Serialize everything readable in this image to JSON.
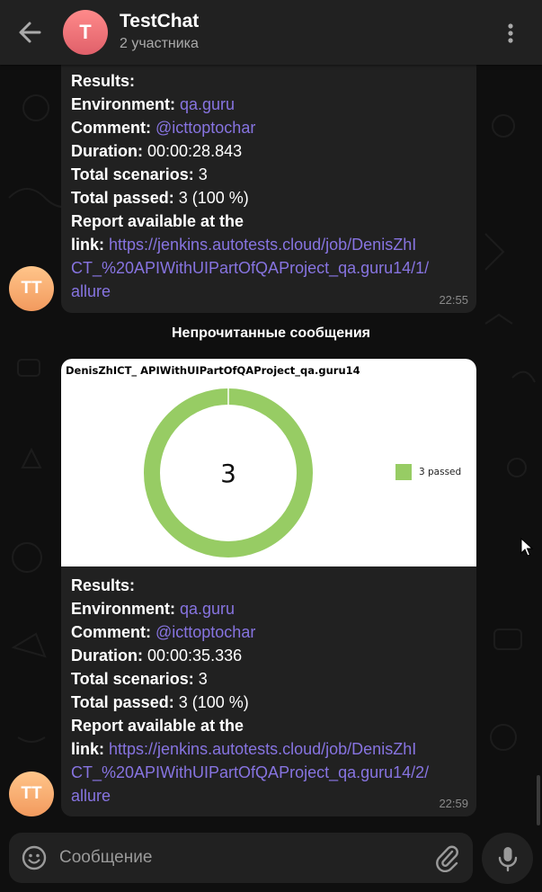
{
  "header": {
    "avatar_letter": "T",
    "title": "TestChat",
    "subtitle": "2 участника",
    "back_icon": "arrow-left-icon",
    "more_icon": "more-vertical-icon"
  },
  "messages": [
    {
      "sender_initials": "TT",
      "lines": [
        {
          "label": "Results:",
          "value": "",
          "link": false
        },
        {
          "label": "Environment: ",
          "value": "qa.guru",
          "link": true
        },
        {
          "label": "Comment: ",
          "value": "@icttoptochar",
          "link": true
        },
        {
          "label": "Duration: ",
          "value": "00:00:28.843",
          "link": false
        },
        {
          "label": "Total scenarios: ",
          "value": "3",
          "link": false
        },
        {
          "label": "Total passed: ",
          "value": "3 (100 %)",
          "link": false
        },
        {
          "label": "Report available at the",
          "value": "",
          "link": false
        },
        {
          "label": "link: ",
          "value": "https://jenkins.autotests.cloud/job/DenisZhI",
          "link": true
        },
        {
          "label": "",
          "value": "CT_%20APIWithUIPartOfQAProject_qa.guru14/1/",
          "link": true
        },
        {
          "label": "",
          "value": "allure",
          "link": true
        }
      ],
      "time": "22:55"
    },
    {
      "sender_initials": "TT",
      "image": {
        "title": "DenisZhICT_ APIWithUIPartOfQAProject_qa.guru14"
      },
      "lines": [
        {
          "label": "Results:",
          "value": "",
          "link": false
        },
        {
          "label": "Environment: ",
          "value": "qa.guru",
          "link": true
        },
        {
          "label": "Comment: ",
          "value": "@icttoptochar",
          "link": true
        },
        {
          "label": "Duration: ",
          "value": "00:00:35.336",
          "link": false
        },
        {
          "label": "Total scenarios: ",
          "value": "3",
          "link": false
        },
        {
          "label": "Total passed: ",
          "value": "3 (100 %)",
          "link": false
        },
        {
          "label": "Report available at the",
          "value": "",
          "link": false
        },
        {
          "label": "link: ",
          "value": "https://jenkins.autotests.cloud/job/DenisZhI",
          "link": true
        },
        {
          "label": "",
          "value": "CT_%20APIWithUIPartOfQAProject_qa.guru14/2/",
          "link": true
        },
        {
          "label": "",
          "value": "allure",
          "link": true
        }
      ],
      "time": "22:59"
    }
  ],
  "unread_divider": "Непрочитанные сообщения",
  "chart_data": {
    "type": "pie",
    "style": "donut",
    "title": "DenisZhICT_ APIWithUIPartOfQAProject_qa.guru14",
    "center_label": "3",
    "slices": [
      {
        "name": "3 passed",
        "value": 3,
        "color": "#97cc64"
      }
    ],
    "legend_position": "right"
  },
  "composer": {
    "placeholder": "Сообщение",
    "emoji_icon": "smile-icon",
    "attach_icon": "paperclip-icon",
    "mic_icon": "microphone-icon"
  },
  "colors": {
    "accent_link": "#8774e1",
    "bubble": "#212121",
    "header": "#212121",
    "passed": "#97cc64"
  }
}
